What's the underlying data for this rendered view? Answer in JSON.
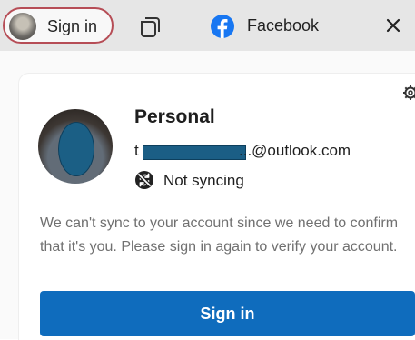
{
  "tabbar": {
    "profile_button_label": "Sign in",
    "tabs_icon": "tab-actions-icon",
    "active_tab": {
      "title": "Facebook",
      "favicon": "facebook-icon",
      "close_icon": "close-icon"
    }
  },
  "flyout": {
    "settings_icon": "gear-icon",
    "profile": {
      "name": "Personal",
      "email_prefix": "t",
      "email_domain": "...@outlook.com"
    },
    "sync": {
      "icon": "sync-off-icon",
      "status": "Not syncing"
    },
    "message": "We can't sync to your account since we need to confirm that it's you. Please sign in again to verify your account.",
    "sign_in_button_label": "Sign in"
  },
  "colors": {
    "accent": "#0f6cbd",
    "facebook_blue": "#1877f2",
    "profile_outline": "#b64d56",
    "redaction": "#1b5e85"
  }
}
